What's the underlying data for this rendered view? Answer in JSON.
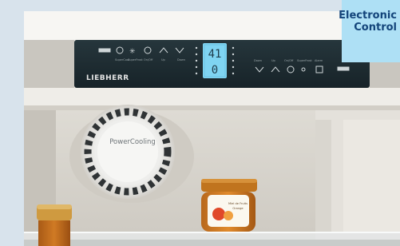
{
  "image": {
    "brand_logo_text": "LIEBHERR",
    "fan_label": "PowerCooling",
    "temperature_display": {
      "top": "41",
      "bottom": "0"
    },
    "jar_label_lines": [
      "Miel de Fruits",
      "Orange"
    ]
  },
  "badge": {
    "line1": "Electronic",
    "line2": "Control"
  },
  "colors": {
    "panel": "#1c2a30",
    "lcd": "#7fd4f2",
    "badge_bg": "#aee0f5",
    "badge_text": "#13447a"
  }
}
